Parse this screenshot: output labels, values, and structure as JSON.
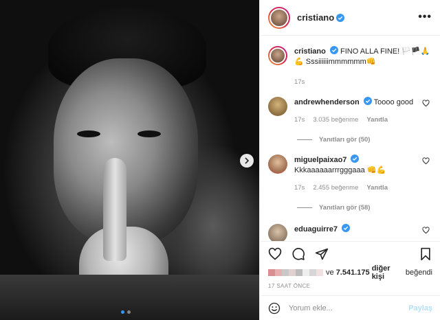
{
  "post": {
    "author": "cristiano",
    "caption": "FINO ALLA FINE! 🏳️🏴🙏 💪 Sssiiiiiimmmmmm👊",
    "caption_time": "17s"
  },
  "comments": [
    {
      "user": "andrewhenderson",
      "verified": true,
      "text": "Toooo good",
      "time": "17s",
      "likes": "3.035 beğenme",
      "reply": "Yanıtla",
      "replies": "Yanıtları gör (50)"
    },
    {
      "user": "miguelpaixao7",
      "verified": true,
      "text": "Kkkaaaaaarrrgggaaa 👊💪",
      "time": "17s",
      "likes": "2.455 beğenme",
      "reply": "Yanıtla",
      "replies": "Yanıtları gör (58)"
    },
    {
      "user": "eduaguirre7",
      "verified": true,
      "text": ""
    }
  ],
  "likes": {
    "count": "7.541.175",
    "suffix": "diğer kişi",
    "verb": "beğendi",
    "prefix": "ve"
  },
  "timestamp": "17 SAAT ÖNCE",
  "comment_box": {
    "placeholder": "Yorum ekle...",
    "post_label": "Paylaş"
  },
  "icons": [
    "heart-icon",
    "comment-icon",
    "share-icon",
    "bookmark-icon",
    "emoji-icon",
    "more-icon",
    "chevron-right-icon",
    "verified-icon"
  ],
  "colors": {
    "verified": "#3897f0",
    "post_disabled": "#b2dffc",
    "muted": "#8e8e8e"
  }
}
